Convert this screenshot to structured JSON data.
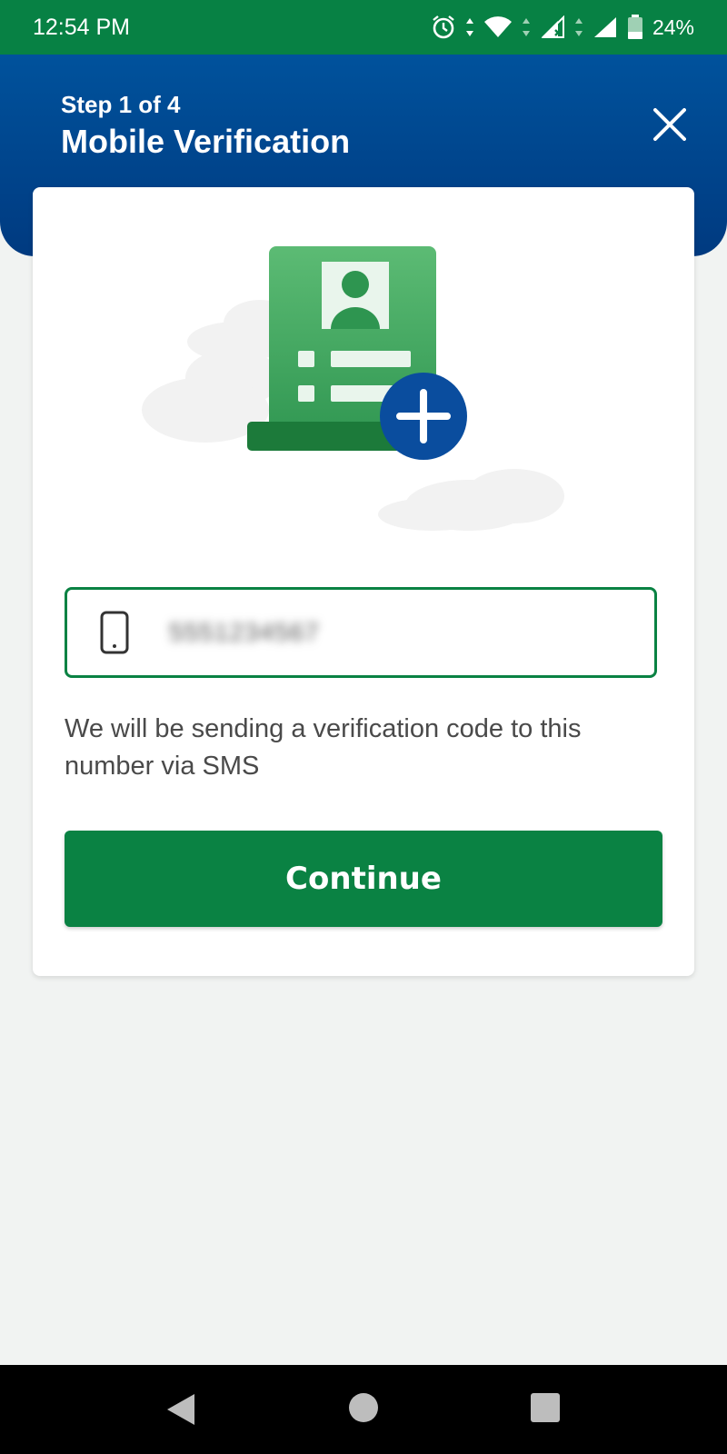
{
  "status_bar": {
    "time": "12:54 PM",
    "battery": "24%",
    "icons": [
      "alarm-icon",
      "wifi-icon",
      "signal-no-data-icon",
      "signal-icon",
      "battery-icon"
    ]
  },
  "header": {
    "step": "Step 1 of 4",
    "title": "Mobile Verification",
    "close_icon": "close-icon"
  },
  "card": {
    "illustration": "id-card-add-icon",
    "phone_input": {
      "icon": "mobile-phone-icon",
      "value": "5551234567"
    },
    "helper_text": "We will be sending a verification code to this number via SMS",
    "continue_label": "Continue"
  },
  "nav_bar": {
    "items": [
      "back-icon",
      "home-icon",
      "recents-icon"
    ]
  },
  "colors": {
    "status_bar": "#078144",
    "header": "#00529c",
    "primary_green": "#0a8243",
    "accent_blue": "#0a4d9e",
    "background": "#f1f3f2"
  }
}
